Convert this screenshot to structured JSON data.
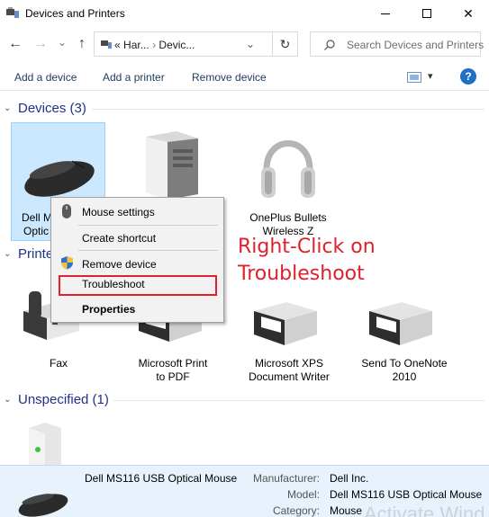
{
  "window": {
    "title": "Devices and Printers",
    "minimize_icon": "minimize-icon",
    "maximize_icon": "maximize-icon",
    "close_icon": "close-icon",
    "close_glyph": "✕"
  },
  "nav": {
    "back_glyph": "←",
    "forward_glyph": "→",
    "recent_glyph": "⌄",
    "up_glyph": "↑",
    "breadcrumb_prefix": "«",
    "breadcrumb_1": "Har...",
    "breadcrumb_sep": "›",
    "breadcrumb_2": "Devic...",
    "dropdown_glyph": "⌄",
    "refresh_glyph": "↻",
    "search_placeholder": "Search Devices and Printers"
  },
  "commands": {
    "add_device": "Add a device",
    "add_printer": "Add a printer",
    "remove_device": "Remove device",
    "view_dropdown_glyph": "▾",
    "help_glyph": "?"
  },
  "groups": {
    "devices": {
      "chevron": "⌄",
      "label": "Devices (3)"
    },
    "printers": {
      "label": "Printe"
    },
    "unspecified": {
      "chevron": "⌄",
      "label": "Unspecified (1)"
    }
  },
  "devices": {
    "mouse_label_1": "Dell M",
    "mouse_label_2": "Optic",
    "headphones_label_1": "OnePlus Bullets",
    "headphones_label_2": "Wireless Z"
  },
  "printers": {
    "fax": "Fax",
    "pdf_1": "Microsoft Print",
    "pdf_2": "to PDF",
    "xps_1": "Microsoft XPS",
    "xps_2": "Document Writer",
    "onenote_1": "Send To OneNote",
    "onenote_2": "2010"
  },
  "context_menu": {
    "mouse_settings": "Mouse settings",
    "create_shortcut": "Create shortcut",
    "remove_device": "Remove device",
    "troubleshoot": "Troubleshoot",
    "properties": "Properties"
  },
  "annotation": {
    "line1": "Right-Click on",
    "line2": "Troubleshoot"
  },
  "details": {
    "name": "Dell MS116 USB Optical Mouse",
    "manufacturer_key": "Manufacturer:",
    "manufacturer_value": "Dell Inc.",
    "model_key": "Model:",
    "model_value": "Dell MS116 USB Optical Mouse",
    "category_key": "Category:",
    "category_value": "Mouse",
    "watermark": "Activate Wind"
  },
  "colors": {
    "accent_red": "#e0202c",
    "group_header": "#1e3287",
    "selection": "#cce8ff"
  }
}
